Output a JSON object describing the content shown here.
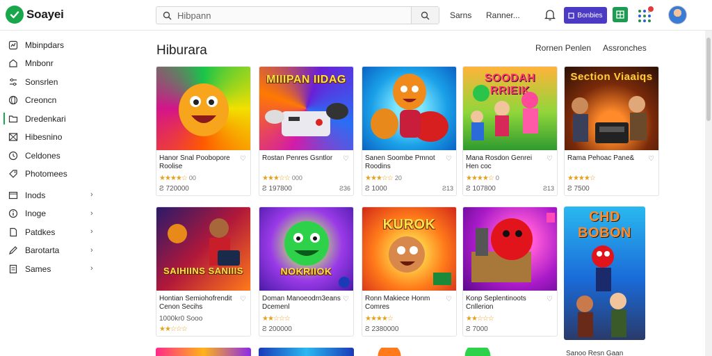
{
  "header": {
    "logo_text": "Soayei",
    "search_placeholder": "Hibpann",
    "links": [
      "Sarns",
      "Ranner..."
    ],
    "primary_button": "Bonbies"
  },
  "sidebar": {
    "items": [
      {
        "label": "Mbinpdars",
        "icon": "chart-icon",
        "chevron": false
      },
      {
        "label": "Mnbonr",
        "icon": "home-icon",
        "chevron": false
      },
      {
        "label": "Sonsrlen",
        "icon": "sliders-icon",
        "chevron": false
      },
      {
        "label": "Creoncn",
        "icon": "globe-icon",
        "chevron": false
      },
      {
        "label": "Dredenkari",
        "icon": "folder-icon",
        "chevron": false,
        "active": true
      },
      {
        "label": "Hibesnino",
        "icon": "box-icon",
        "chevron": false
      },
      {
        "label": "Celdones",
        "icon": "clock-icon",
        "chevron": false
      },
      {
        "label": "Photomees",
        "icon": "tag-icon",
        "chevron": false
      },
      {
        "label": "Inods",
        "icon": "window-icon",
        "chevron": true
      },
      {
        "label": "Inoge",
        "icon": "info-icon",
        "chevron": true
      },
      {
        "label": "Patdkes",
        "icon": "file-icon",
        "chevron": true
      },
      {
        "label": "Barotarta",
        "icon": "pencil-icon",
        "chevron": true
      },
      {
        "label": "Sames",
        "icon": "doc-icon",
        "chevron": true
      }
    ]
  },
  "main": {
    "title": "Hiburara",
    "sort_links": [
      "Rornen Penlen",
      "Assronches"
    ],
    "cards": [
      {
        "title": "Hanor Snal Poobopore Roolise",
        "rating": "★★★★☆",
        "score": "00",
        "price": "Ƨ 720000",
        "extra": "",
        "thumb_text": ""
      },
      {
        "title": "Rostan Penres Gsntlor",
        "rating": "★★★☆☆",
        "score": "000",
        "price": "Ƨ 197800",
        "extra": "Ƨ36",
        "thumb_text": "MIIIPAN IIDAG"
      },
      {
        "title": "Sanen Soombe Pmnot Roodins",
        "rating": "★★★☆☆",
        "score": "20",
        "price": "Ƨ 1000",
        "extra": "Ƨ13",
        "thumb_text": ""
      },
      {
        "title": "Mana Rosdon Genrei Hen coc",
        "rating": "★★★★☆",
        "score": "0",
        "price": "Ƨ 107800",
        "extra": "Ƨ13",
        "thumb_text": "SOODAH RRIEIK"
      },
      {
        "title": "Rama Pehoac Pane&",
        "rating": "★★★★☆",
        "score": "",
        "price": "Ƨ 7500",
        "extra": "",
        "thumb_text": "Section Viaaiqs"
      },
      {
        "title": "Hontian Semiohofrendit Cenon Secihs",
        "rating": "",
        "score": "",
        "price": "1000kr0 Sooo",
        "extra": "",
        "thumb_text": "SAIHIINS SANIIIS"
      },
      {
        "title": "Doman Manoeodrn3eans Dcemenl",
        "rating": "★★☆☆☆",
        "score": "",
        "price": "Ƨ 200000",
        "extra": "",
        "thumb_text": "NOKRIIOK"
      },
      {
        "title": "Ronn Makiece Honm Comres",
        "rating": "★★★★☆",
        "score": "",
        "price": "Ƨ 2380000",
        "extra": "",
        "thumb_text": "KUROK"
      },
      {
        "title": "Konp Seplentinoots Cnllerion",
        "rating": "★★☆☆☆",
        "score": "",
        "price": "Ƨ 7000",
        "extra": "",
        "thumb_text": ""
      },
      {
        "title": "",
        "rating": "",
        "score": "",
        "price": "",
        "extra": "",
        "thumb_text": "CHD BOBON"
      }
    ],
    "bottom_text": "Sanoo Resn Gaan"
  }
}
